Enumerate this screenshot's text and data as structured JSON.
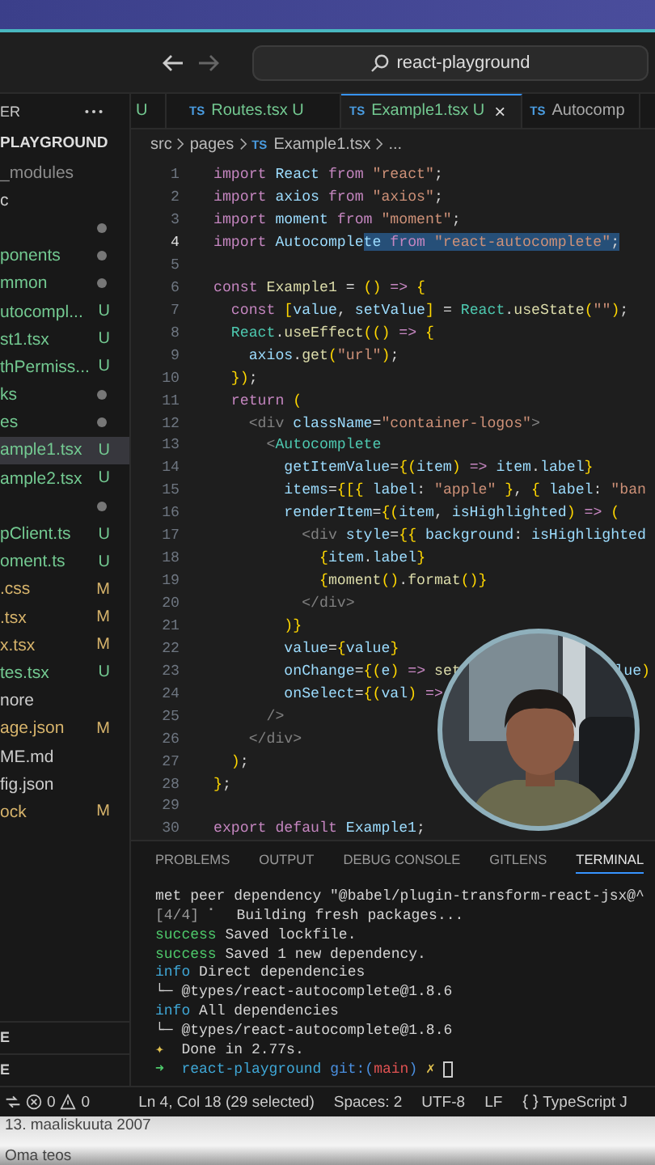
{
  "titlebar": {
    "search": "react-playground"
  },
  "sidebar": {
    "header": "ER",
    "root": "PLAYGROUND",
    "items": [
      {
        "label": "_modules",
        "kind": "ignored",
        "selected": false
      },
      {
        "label": "c",
        "kind": "plain",
        "selected": false
      },
      {
        "kind": "folder",
        "selected": false
      },
      {
        "label": "ponents",
        "kind": "folder",
        "selected": false
      },
      {
        "label": "mmon",
        "kind": "folder",
        "selected": false
      },
      {
        "label": "utocompl...",
        "kind": "untracked",
        "badge": "U",
        "selected": false
      },
      {
        "label": "st1.tsx",
        "kind": "untracked",
        "badge": "U",
        "selected": false
      },
      {
        "label": "thPermiss...",
        "kind": "untracked",
        "badge": "U",
        "selected": false
      },
      {
        "label": "ks",
        "kind": "folder",
        "selected": false
      },
      {
        "label": "es",
        "kind": "folder",
        "selected": false
      },
      {
        "label": "ample1.tsx",
        "kind": "untracked",
        "badge": "U",
        "selected": true
      },
      {
        "label": "ample2.tsx",
        "kind": "untracked",
        "badge": "U",
        "selected": false
      },
      {
        "kind": "folder",
        "selected": false
      },
      {
        "label": "pClient.ts",
        "kind": "untracked",
        "badge": "U",
        "selected": false
      },
      {
        "label": "oment.ts",
        "kind": "untracked",
        "badge": "U",
        "selected": false
      },
      {
        "label": ".css",
        "kind": "modified",
        "badge": "M",
        "selected": false
      },
      {
        "label": ".tsx",
        "kind": "modified",
        "badge": "M",
        "selected": false
      },
      {
        "label": "x.tsx",
        "kind": "modified",
        "badge": "M",
        "selected": false
      },
      {
        "label": "tes.tsx",
        "kind": "untracked",
        "badge": "U",
        "selected": false
      },
      {
        "label": "nore",
        "kind": "plain",
        "selected": false
      },
      {
        "label": "age.json",
        "kind": "modified",
        "badge": "M",
        "selected": false
      },
      {
        "label": "ME.md",
        "kind": "plain",
        "selected": false
      },
      {
        "label": "fig.json",
        "kind": "plain",
        "selected": false
      },
      {
        "label": "ock",
        "kind": "modified",
        "badge": "M",
        "selected": false
      }
    ],
    "sections": [
      "E",
      "E"
    ]
  },
  "tabs": [
    {
      "label": "U",
      "selected": false
    },
    {
      "icon": "TS",
      "label": "Routes.tsx U",
      "selected": false
    },
    {
      "icon": "TS",
      "label": "Example1.tsx U",
      "close": "×",
      "selected": true
    },
    {
      "icon": "TS",
      "label": "Autocomp",
      "selected": false
    }
  ],
  "breadcrumb": {
    "parts": [
      "src",
      "pages"
    ],
    "icon": "TS",
    "file": "Example1.tsx",
    "more": "..."
  },
  "code": [
    {
      "n": "1",
      "active": false,
      "tokens": [
        {
          "kind": "kw",
          "t": "import "
        },
        {
          "kind": "id",
          "t": "React "
        },
        {
          "kind": "kw",
          "t": "from "
        },
        {
          "kind": "str",
          "t": "\"react\""
        },
        {
          "kind": "pl",
          "t": ";"
        }
      ]
    },
    {
      "n": "2",
      "active": false,
      "tokens": [
        {
          "kind": "kw",
          "t": "import "
        },
        {
          "kind": "id",
          "t": "axios "
        },
        {
          "kind": "kw",
          "t": "from "
        },
        {
          "kind": "str",
          "t": "\"axios\""
        },
        {
          "kind": "pl",
          "t": ";"
        }
      ]
    },
    {
      "n": "3",
      "active": false,
      "tokens": [
        {
          "kind": "kw",
          "t": "import "
        },
        {
          "kind": "id",
          "t": "moment "
        },
        {
          "kind": "kw",
          "t": "from "
        },
        {
          "kind": "str",
          "t": "\"moment\""
        },
        {
          "kind": "pl",
          "t": ";"
        }
      ]
    },
    {
      "n": "4",
      "active": true,
      "tokens": [
        {
          "kind": "kw",
          "t": "import "
        },
        {
          "kind": "id",
          "t": "Autocomple",
          "sel": false
        },
        {
          "kind": "id",
          "t": "te",
          "sel": true
        },
        {
          "kind": "kw",
          "t": " from ",
          "sel": true
        },
        {
          "kind": "str",
          "t": "\"react-autocomplete\"",
          "sel": true
        },
        {
          "kind": "pl",
          "t": ";",
          "sel": true
        }
      ]
    },
    {
      "n": "5",
      "active": false
    },
    {
      "n": "6",
      "active": false,
      "tokens": [
        {
          "kind": "kw",
          "t": "const "
        },
        {
          "kind": "fn",
          "t": "Example1"
        },
        {
          "kind": "pl",
          "t": " = "
        },
        {
          "kind": "br",
          "t": "() "
        },
        {
          "kind": "kw",
          "t": "=> "
        },
        {
          "kind": "br",
          "t": "{"
        }
      ]
    },
    {
      "n": "7",
      "active": false,
      "tokens": [
        {
          "kind": "kw",
          "t": "  const "
        },
        {
          "kind": "br",
          "t": "["
        },
        {
          "kind": "id",
          "t": "value"
        },
        {
          "kind": "pl",
          "t": ", "
        },
        {
          "kind": "id",
          "t": "setValue"
        },
        {
          "kind": "br",
          "t": "]"
        },
        {
          "kind": "pl",
          "t": " = "
        },
        {
          "kind": "cls",
          "t": "React"
        },
        {
          "kind": "pl",
          "t": "."
        },
        {
          "kind": "fn",
          "t": "useState"
        },
        {
          "kind": "br",
          "t": "("
        },
        {
          "kind": "str",
          "t": "\"\""
        },
        {
          "kind": "br",
          "t": ")"
        },
        {
          "kind": "pl",
          "t": ";"
        }
      ]
    },
    {
      "n": "8",
      "active": false,
      "tokens": [
        {
          "kind": "cls",
          "t": "  React"
        },
        {
          "kind": "pl",
          "t": "."
        },
        {
          "kind": "fn",
          "t": "useEffect"
        },
        {
          "kind": "br",
          "t": "(() "
        },
        {
          "kind": "kw",
          "t": "=> "
        },
        {
          "kind": "br",
          "t": "{"
        }
      ]
    },
    {
      "n": "9",
      "active": false,
      "tokens": [
        {
          "kind": "id",
          "t": "    axios"
        },
        {
          "kind": "pl",
          "t": "."
        },
        {
          "kind": "fn",
          "t": "get"
        },
        {
          "kind": "br",
          "t": "("
        },
        {
          "kind": "str",
          "t": "\"url\""
        },
        {
          "kind": "br",
          "t": ")"
        },
        {
          "kind": "pl",
          "t": ";"
        }
      ]
    },
    {
      "n": "10",
      "active": false,
      "tokens": [
        {
          "kind": "br",
          "t": "  })"
        },
        {
          "kind": "pl",
          "t": ";"
        }
      ]
    },
    {
      "n": "11",
      "active": false,
      "tokens": [
        {
          "kind": "kw",
          "t": "  return "
        },
        {
          "kind": "br",
          "t": "("
        }
      ]
    },
    {
      "n": "12",
      "active": false,
      "tokens": [
        {
          "kind": "tag",
          "t": "    <div "
        },
        {
          "kind": "attr",
          "t": "className"
        },
        {
          "kind": "pl",
          "t": "="
        },
        {
          "kind": "str",
          "t": "\"container-logos\""
        },
        {
          "kind": "tag",
          "t": ">"
        }
      ]
    },
    {
      "n": "13",
      "active": false,
      "tokens": [
        {
          "kind": "tag",
          "t": "      <"
        },
        {
          "kind": "cls",
          "t": "Autocomplete"
        }
      ]
    },
    {
      "n": "14",
      "active": false,
      "tokens": [
        {
          "kind": "attr",
          "t": "        getItemValue"
        },
        {
          "kind": "pl",
          "t": "="
        },
        {
          "kind": "br",
          "t": "{("
        },
        {
          "kind": "id",
          "t": "item"
        },
        {
          "kind": "br",
          "t": ") "
        },
        {
          "kind": "kw",
          "t": "=> "
        },
        {
          "kind": "id",
          "t": "item"
        },
        {
          "kind": "pl",
          "t": "."
        },
        {
          "kind": "id",
          "t": "label"
        },
        {
          "kind": "br",
          "t": "}"
        }
      ]
    },
    {
      "n": "15",
      "active": false,
      "tokens": [
        {
          "kind": "attr",
          "t": "        items"
        },
        {
          "kind": "pl",
          "t": "="
        },
        {
          "kind": "br",
          "t": "{[{ "
        },
        {
          "kind": "id",
          "t": "label"
        },
        {
          "kind": "pl",
          "t": ": "
        },
        {
          "kind": "str",
          "t": "\"apple\""
        },
        {
          "kind": "br",
          "t": " }"
        },
        {
          "kind": "pl",
          "t": ", "
        },
        {
          "kind": "br",
          "t": "{ "
        },
        {
          "kind": "id",
          "t": "label"
        },
        {
          "kind": "pl",
          "t": ": "
        },
        {
          "kind": "str",
          "t": "\"ban"
        }
      ]
    },
    {
      "n": "16",
      "active": false,
      "tokens": [
        {
          "kind": "attr",
          "t": "        renderItem"
        },
        {
          "kind": "pl",
          "t": "="
        },
        {
          "kind": "br",
          "t": "{("
        },
        {
          "kind": "id",
          "t": "item"
        },
        {
          "kind": "pl",
          "t": ", "
        },
        {
          "kind": "id",
          "t": "isHighlighted"
        },
        {
          "kind": "br",
          "t": ") "
        },
        {
          "kind": "kw",
          "t": "=> "
        },
        {
          "kind": "br",
          "t": "("
        }
      ]
    },
    {
      "n": "17",
      "active": false,
      "tokens": [
        {
          "kind": "tag",
          "t": "          <div "
        },
        {
          "kind": "attr",
          "t": "style"
        },
        {
          "kind": "pl",
          "t": "="
        },
        {
          "kind": "br",
          "t": "{{ "
        },
        {
          "kind": "id",
          "t": "background"
        },
        {
          "kind": "pl",
          "t": ": "
        },
        {
          "kind": "id",
          "t": "isHighlighted"
        }
      ]
    },
    {
      "n": "18",
      "active": false,
      "tokens": [
        {
          "kind": "br",
          "t": "            {"
        },
        {
          "kind": "id",
          "t": "item"
        },
        {
          "kind": "pl",
          "t": "."
        },
        {
          "kind": "id",
          "t": "label"
        },
        {
          "kind": "br",
          "t": "}"
        }
      ]
    },
    {
      "n": "19",
      "active": false,
      "tokens": [
        {
          "kind": "br",
          "t": "            {"
        },
        {
          "kind": "fn",
          "t": "moment"
        },
        {
          "kind": "br",
          "t": "()"
        },
        {
          "kind": "pl",
          "t": "."
        },
        {
          "kind": "fn",
          "t": "format"
        },
        {
          "kind": "br",
          "t": "()}"
        }
      ]
    },
    {
      "n": "20",
      "active": false,
      "tokens": [
        {
          "kind": "tag",
          "t": "          </div>"
        }
      ]
    },
    {
      "n": "21",
      "active": false,
      "tokens": [
        {
          "kind": "br",
          "t": "        )}"
        }
      ]
    },
    {
      "n": "22",
      "active": false,
      "tokens": [
        {
          "kind": "attr",
          "t": "        value"
        },
        {
          "kind": "pl",
          "t": "="
        },
        {
          "kind": "br",
          "t": "{"
        },
        {
          "kind": "id",
          "t": "value"
        },
        {
          "kind": "br",
          "t": "}"
        }
      ]
    },
    {
      "n": "23",
      "active": false,
      "tokens": [
        {
          "kind": "attr",
          "t": "        onChange"
        },
        {
          "kind": "pl",
          "t": "="
        },
        {
          "kind": "br",
          "t": "{("
        },
        {
          "kind": "id",
          "t": "e"
        },
        {
          "kind": "br",
          "t": ") "
        },
        {
          "kind": "kw",
          "t": "=> "
        },
        {
          "kind": "fn",
          "t": "set"
        }
      ],
      "tail": [
        {
          "kind": "id",
          "t": "lue"
        },
        {
          "kind": "br",
          "t": ")"
        }
      ]
    },
    {
      "n": "24",
      "active": false,
      "tokens": [
        {
          "kind": "attr",
          "t": "        onSelect"
        },
        {
          "kind": "pl",
          "t": "="
        },
        {
          "kind": "br",
          "t": "{("
        },
        {
          "kind": "id",
          "t": "val"
        },
        {
          "kind": "br",
          "t": ") "
        },
        {
          "kind": "kw",
          "t": "=>"
        }
      ]
    },
    {
      "n": "25",
      "active": false,
      "tokens": [
        {
          "kind": "tag",
          "t": "      />"
        }
      ]
    },
    {
      "n": "26",
      "active": false,
      "tokens": [
        {
          "kind": "tag",
          "t": "    </div>"
        }
      ]
    },
    {
      "n": "27",
      "active": false,
      "tokens": [
        {
          "kind": "br",
          "t": "  )"
        },
        {
          "kind": "pl",
          "t": ";"
        }
      ]
    },
    {
      "n": "28",
      "active": false,
      "tokens": [
        {
          "kind": "br",
          "t": "}"
        },
        {
          "kind": "pl",
          "t": ";"
        }
      ]
    },
    {
      "n": "29",
      "active": false
    },
    {
      "n": "30",
      "active": false,
      "tokens": [
        {
          "kind": "kw",
          "t": "export default "
        },
        {
          "kind": "id",
          "t": "Example1"
        },
        {
          "kind": "pl",
          "t": ";"
        }
      ]
    }
  ],
  "webcam": {
    "kind": "picture"
  },
  "panel_tabs": [
    {
      "label": "PROBLEMS",
      "selected": false
    },
    {
      "label": "OUTPUT",
      "selected": false
    },
    {
      "label": "DEBUG CONSOLE",
      "selected": false
    },
    {
      "label": "GITLENS",
      "selected": false
    },
    {
      "label": "TERMINAL",
      "selected": true
    }
  ],
  "terminal": [
    [
      {
        "kind": "pl",
        "t": "met peer dependency \"@babel/plugin-transform-react-jsx@^"
      }
    ],
    [
      {
        "kind": "dim",
        "t": "[4/4] ⠁  "
      },
      {
        "kind": "pl",
        "t": "Building fresh packages..."
      }
    ],
    [
      {
        "kind": "ok",
        "t": "success "
      },
      {
        "kind": "pl",
        "t": "Saved lockfile."
      }
    ],
    [
      {
        "kind": "ok",
        "t": "success "
      },
      {
        "kind": "pl",
        "t": "Saved 1 new dependency."
      }
    ],
    [
      {
        "kind": "info",
        "t": "info "
      },
      {
        "kind": "pl",
        "t": "Direct dependencies"
      }
    ],
    [
      {
        "kind": "pl",
        "t": "└─ @types/react-autocomplete@1.8.6"
      }
    ],
    [
      {
        "kind": "info",
        "t": "info "
      },
      {
        "kind": "pl",
        "t": "All dependencies"
      }
    ],
    [
      {
        "kind": "pl",
        "t": "└─ @types/react-autocomplete@1.8.6"
      }
    ],
    [
      {
        "kind": "warn",
        "t": "✦  "
      },
      {
        "kind": "pl",
        "t": "Done in 2.77s."
      }
    ],
    [
      {
        "kind": "ok",
        "t": "➜  "
      },
      {
        "kind": "info",
        "t": "react-playground "
      },
      {
        "kind": "git",
        "t": "git:("
      },
      {
        "kind": "err",
        "t": "main"
      },
      {
        "kind": "git",
        "t": ") "
      },
      {
        "kind": "warn",
        "t": "✗ "
      }
    ]
  ],
  "status_bar": {
    "errors": "0",
    "warnings": "0",
    "items": [
      "Ln 4, Col 18 (29 selected)",
      "Spaces: 2",
      "UTF-8",
      "LF",
      "TypeScript J"
    ]
  },
  "below_window": [
    "13. maaliskuuta 2007",
    "Oma teos"
  ]
}
